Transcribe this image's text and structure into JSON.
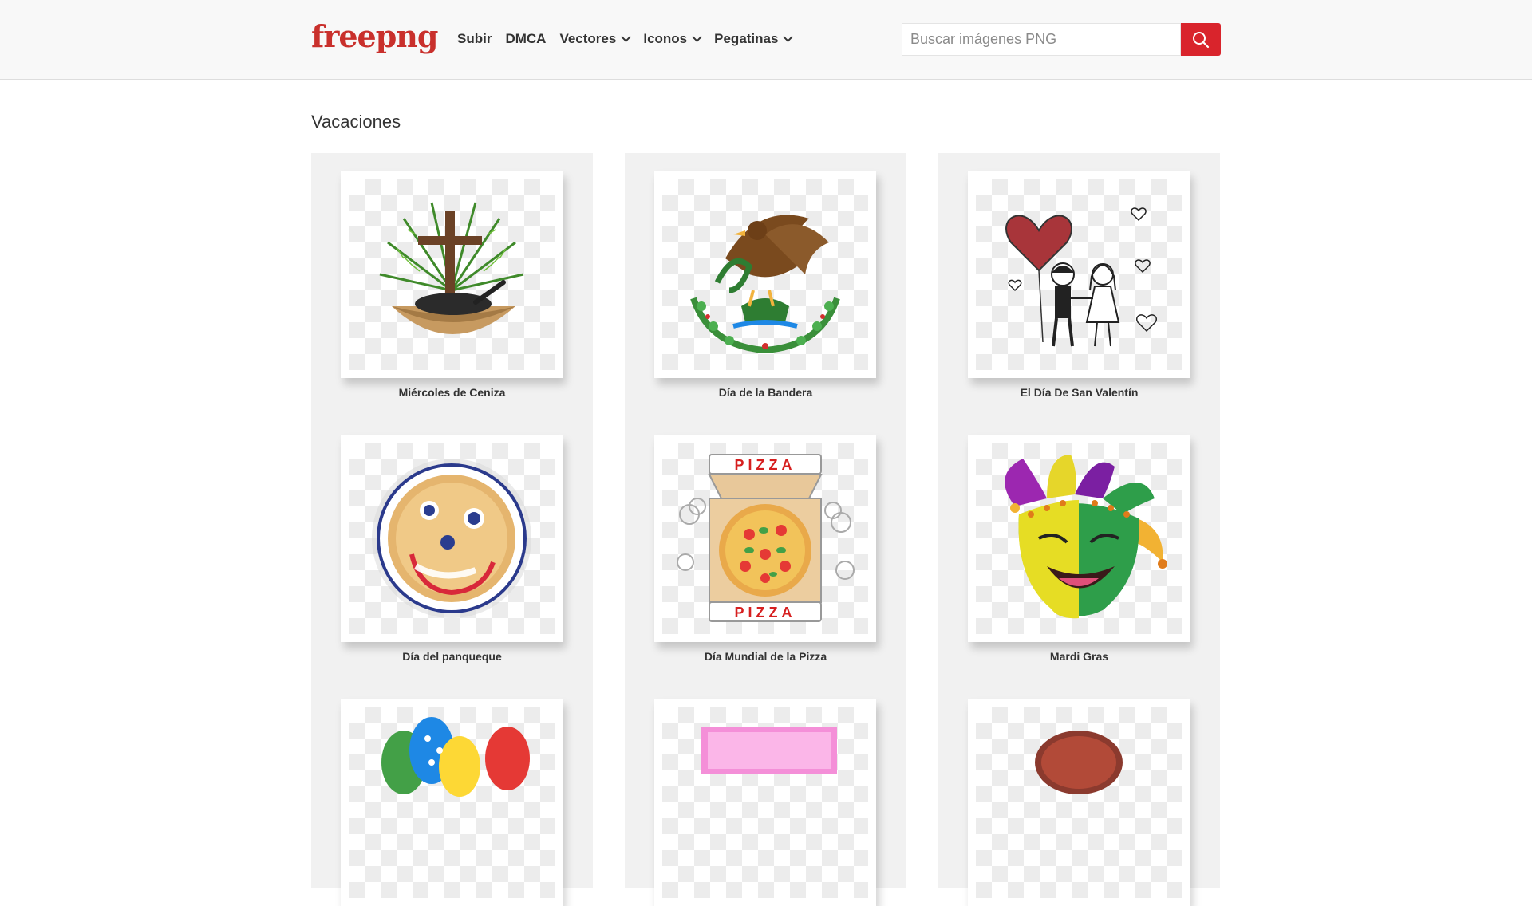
{
  "header": {
    "logo": "freepng",
    "nav": [
      {
        "label": "Subir",
        "dropdown": false
      },
      {
        "label": "DMCA",
        "dropdown": false
      },
      {
        "label": "Vectores",
        "dropdown": true
      },
      {
        "label": "Iconos",
        "dropdown": true
      },
      {
        "label": "Pegatinas",
        "dropdown": true
      }
    ],
    "search": {
      "placeholder": "Buscar imágenes PNG",
      "value": "",
      "icon": "search-icon"
    }
  },
  "section": {
    "title": "Vacaciones"
  },
  "items": [
    {
      "title": "Miércoles de Ceniza",
      "icon": "ash-wednesday-image"
    },
    {
      "title": "Día de la Bandera",
      "icon": "mexican-eagle-image"
    },
    {
      "title": "El Día De San Valentín",
      "icon": "valentine-couple-image"
    },
    {
      "title": "Día del panqueque",
      "icon": "pancake-face-image"
    },
    {
      "title": "Día Mundial de la Pizza",
      "icon": "pizza-box-image"
    },
    {
      "title": "Mardi Gras",
      "icon": "jester-mask-image"
    },
    {
      "title": "",
      "icon": "easter-eggs-image"
    },
    {
      "title": "",
      "icon": "pink-card-image"
    },
    {
      "title": "",
      "icon": "badge-image"
    }
  ],
  "colors": {
    "brand": "#c9302c",
    "search_button": "#d9242c",
    "card_bg": "#f1f1f1"
  }
}
